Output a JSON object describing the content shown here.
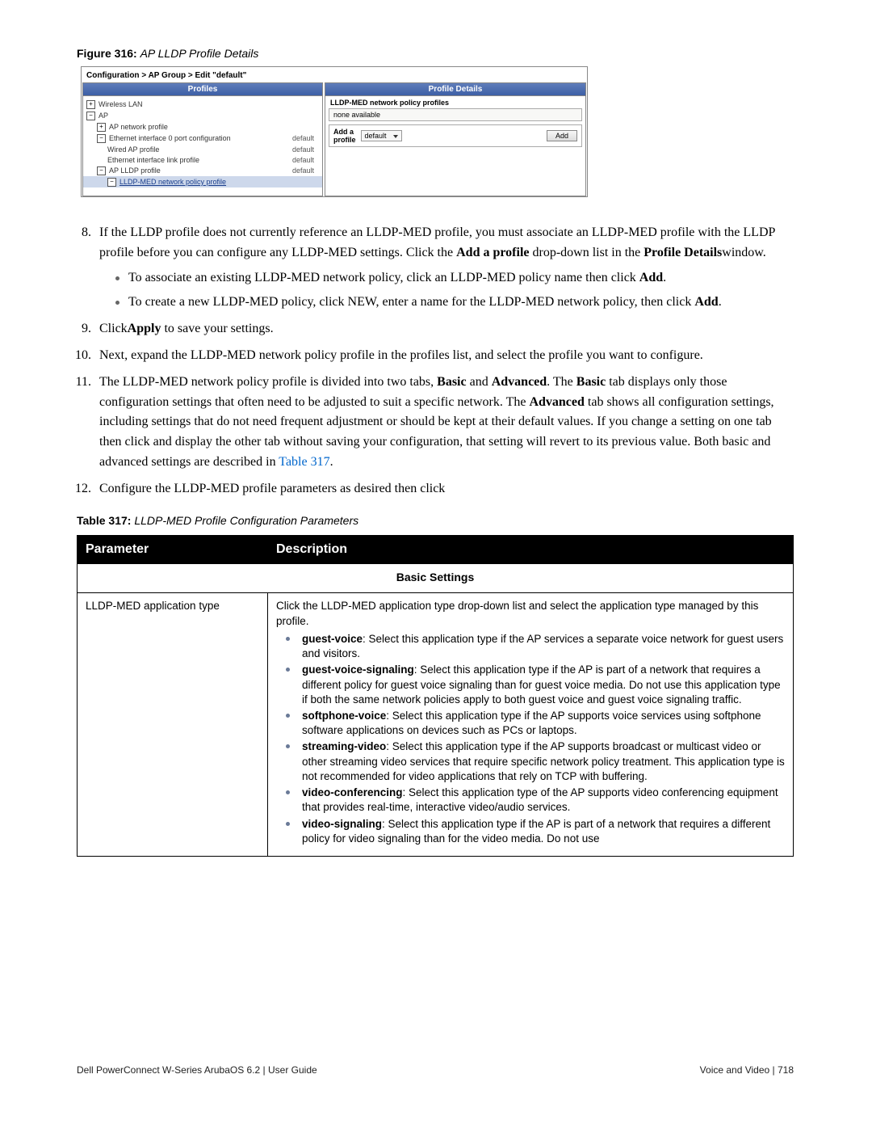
{
  "figure": {
    "label": "Figure 316:",
    "title": "AP LLDP Profile Details"
  },
  "shot": {
    "breadcrumb": "Configuration > AP Group > Edit \"default\"",
    "left_head": "Profiles",
    "right_head": "Profile Details",
    "wireless_lan": "Wireless LAN",
    "ap": "AP",
    "ap_network_profile": "AP network profile",
    "eth0": "Ethernet interface 0 port configuration",
    "wired_ap": "Wired AP profile",
    "eth_link": "Ethernet interface link profile",
    "ap_lldp": "AP LLDP profile",
    "lldp_med_np": "LLDP-MED network policy profile",
    "default": "default",
    "rb_header": "LLDP-MED network policy profiles",
    "none_available": "none available",
    "add_a": "Add a",
    "profile": "profile",
    "dd_default": "default",
    "add_btn": "Add"
  },
  "list": {
    "i8": {
      "p1a": "If the LLDP profile does not currently reference an LLDP-MED profile, you must associate an LLDP-MED profile with the LLDP profile before you can configure any LLDP-MED settings. Click the ",
      "p1b": "Add a profile",
      "p1c": " drop-down list in the ",
      "p1d": "Profile Details",
      "p1e": "window.",
      "b1a": "To associate an existing LLDP-MED network policy, click an LLDP-MED policy name then click ",
      "b1b": "Add",
      "b1c": ".",
      "b2a": "To create a new LLDP-MED policy, click NEW, enter a name for the LLDP-MED network policy, then click ",
      "b2b": "Add",
      "b2c": "."
    },
    "i9": {
      "a": "Click",
      "b": "Apply",
      "c": " to save your settings."
    },
    "i10": "Next, expand the LLDP-MED network policy profile in the profiles list, and select the profile you want to configure.",
    "i11": {
      "a": "The LLDP-MED network policy profile is divided into two tabs, ",
      "b": "Basic",
      "c": " and ",
      "d": "Advanced",
      "e": ". The ",
      "f": "Basic",
      "g": " tab displays only those configuration settings that often need to be adjusted to suit a specific network. The ",
      "h": "Advanced",
      "i": " tab shows all configuration settings, including settings that do not need frequent adjustment or should be kept at their default values. If you change a setting on one tab then click and display the other tab without saving your configuration, that setting will revert to its previous value. Both basic and advanced settings are described in ",
      "link": "Table 317",
      "j": "."
    },
    "i12": "Configure the LLDP-MED profile parameters as desired then click"
  },
  "table": {
    "label": "Table 317:",
    "title": "LLDP-MED Profile Configuration Parameters",
    "h1": "Parameter",
    "h2": "Description",
    "section": "Basic Settings",
    "r1c1": "LLDP-MED application type",
    "r1": {
      "intro": "Click the LLDP-MED application type drop-down list and select the application type managed by this profile.",
      "gv_b": "guest-voice",
      "gv_t": ": Select this application type if the AP services a separate voice network for guest users and visitors.",
      "gvs_b": "guest-voice-signaling",
      "gvs_t": ": Select this application type if the AP is part of a network that requires a different policy for guest voice signaling than for guest voice media. Do not use this application type if both the same network policies apply to both guest voice and guest voice signaling traffic.",
      "sp_b": "softphone-voice",
      "sp_t": ": Select this application type if the AP supports voice services using softphone software applications on devices such as PCs or laptops.",
      "sv_b": "streaming-video",
      "sv_t": ": Select this application type if the AP supports broadcast or multicast video or other streaming video services that require specific network policy treatment. This application type is not recommended for video applications that rely on TCP with buffering.",
      "vc_b": "video-conferencing",
      "vc_t": ": Select this application type of the AP supports video conferencing equipment that provides real-time, interactive video/audio services.",
      "vs_b": "video-signaling",
      "vs_t": ": Select this application type if the AP is part of a network that requires a different policy for video signaling than for the video media. Do not use"
    }
  },
  "footer": {
    "left": "Dell PowerConnect W-Series ArubaOS 6.2   |   User Guide",
    "right": "Voice and Video   |  718"
  }
}
